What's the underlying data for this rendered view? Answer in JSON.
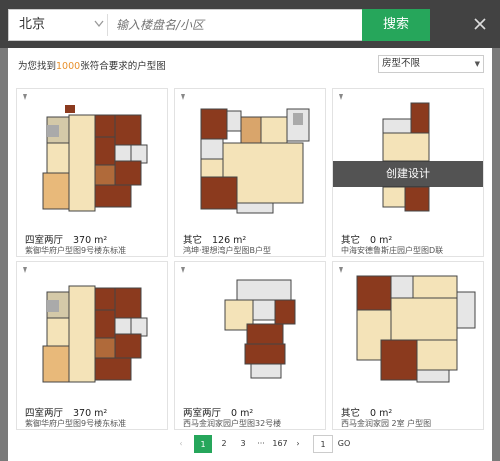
{
  "search": {
    "city": "北京",
    "keyword_placeholder": "输入楼盘名/小区",
    "button_label": "搜索"
  },
  "results": {
    "prefix": "为您找到",
    "count": "1000",
    "suffix": "张符合要求的户型图",
    "filter_selected": "房型不限"
  },
  "cards": [
    {
      "type": "四室两厅",
      "area": "370 m²",
      "name": "紫御华府户型图9号楼东标准"
    },
    {
      "type": "其它",
      "area": "126 m²",
      "name": "鸿坤·理想湾户型图B户型"
    },
    {
      "type": "其它",
      "area": "0 m²",
      "name": "中海安德鲁斯庄园户型图D联",
      "overlay": "创建设计"
    },
    {
      "type": "四室两厅",
      "area": "370 m²",
      "name": "紫御华府户型图9号楼东标准"
    },
    {
      "type": "两室两厅",
      "area": "0 m²",
      "name": "西马金润家园户型图32号楼"
    },
    {
      "type": "其它",
      "area": "0 m²",
      "name": "西马金润家园 2室 户型图"
    }
  ],
  "pagination": {
    "prev": "‹",
    "pages": [
      "1",
      "2",
      "3"
    ],
    "ellipsis": "···",
    "last": "167",
    "next": "›",
    "goto_value": "1",
    "go_label": "GO"
  },
  "colors": {
    "accent": "#26a65b",
    "count_highlight": "#e8912d",
    "room_brown": "#8b3a1e"
  },
  "icons": {
    "close": "close-icon",
    "city_dropdown": "chevron-down-icon",
    "pin": "pin-icon"
  }
}
